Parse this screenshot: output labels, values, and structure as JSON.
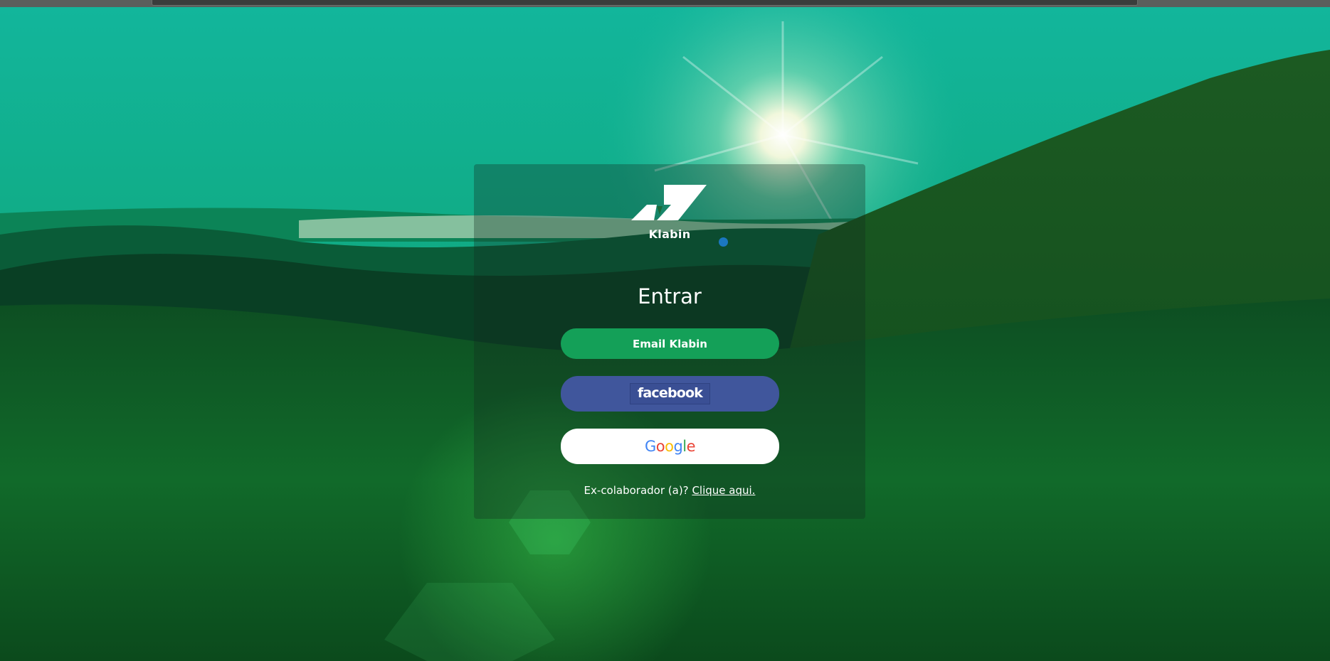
{
  "login": {
    "logo_name": "Klabin",
    "heading": "Entrar",
    "email_button_label": "Email Klabin",
    "facebook_button_label": "facebook",
    "google_button_letters": [
      "G",
      "o",
      "o",
      "g",
      "l",
      "e"
    ],
    "former_employee_prompt": "Ex-colaborador (a)?",
    "former_employee_link": "Clique aqui."
  },
  "colors": {
    "email_button": "#14a058",
    "facebook_button": "#40569c",
    "google_button": "#ffffff",
    "sky": "#12b58a",
    "grass": "#0b5a24"
  },
  "icons": {
    "logo": "klabin-logo-icon",
    "sun": "sun-flare"
  }
}
